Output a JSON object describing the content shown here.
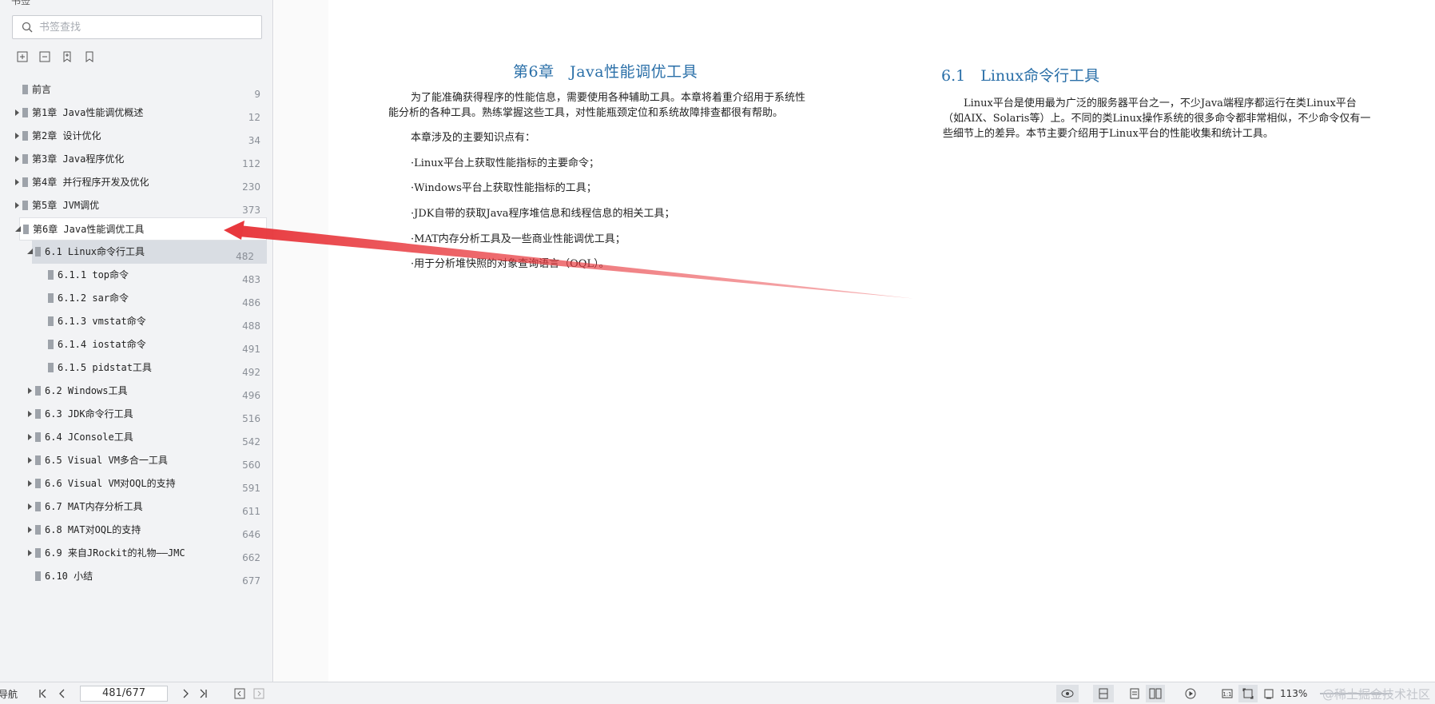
{
  "sidebar": {
    "top_left_label": "书签",
    "search_placeholder": "书签查找",
    "outline": [
      {
        "label": "前言",
        "page": "9",
        "level": 0,
        "expander": "none",
        "cjk": true
      },
      {
        "label": "第1章 Java性能调优概述",
        "page": "12",
        "level": 0,
        "expander": "collapsed"
      },
      {
        "label": "第2章 设计优化",
        "page": "34",
        "level": 0,
        "expander": "collapsed"
      },
      {
        "label": "第3章 Java程序优化",
        "page": "112",
        "level": 0,
        "expander": "collapsed"
      },
      {
        "label": "第4章 并行程序开发及优化",
        "page": "230",
        "level": 0,
        "expander": "collapsed"
      },
      {
        "label": "第5章 JVM调优",
        "page": "373",
        "level": 0,
        "expander": "collapsed"
      },
      {
        "label": "第6章 Java性能调优工具",
        "page": "",
        "level": 0,
        "expander": "expanded",
        "state": "selected"
      },
      {
        "label": "6.1 Linux命令行工具",
        "page": "482",
        "level": 1,
        "expander": "expanded",
        "state": "hover"
      },
      {
        "label": "6.1.1 top命令",
        "page": "483",
        "level": 2,
        "expander": "none"
      },
      {
        "label": "6.1.2 sar命令",
        "page": "486",
        "level": 2,
        "expander": "none"
      },
      {
        "label": "6.1.3 vmstat命令",
        "page": "488",
        "level": 2,
        "expander": "none"
      },
      {
        "label": "6.1.4 iostat命令",
        "page": "491",
        "level": 2,
        "expander": "none"
      },
      {
        "label": "6.1.5 pidstat工具",
        "page": "492",
        "level": 2,
        "expander": "none"
      },
      {
        "label": "6.2 Windows工具",
        "page": "496",
        "level": 1,
        "expander": "collapsed"
      },
      {
        "label": "6.3 JDK命令行工具",
        "page": "516",
        "level": 1,
        "expander": "collapsed"
      },
      {
        "label": "6.4 JConsole工具",
        "page": "542",
        "level": 1,
        "expander": "collapsed"
      },
      {
        "label": "6.5 Visual VM多合一工具",
        "page": "560",
        "level": 1,
        "expander": "collapsed"
      },
      {
        "label": "6.6 Visual VM对OQL的支持",
        "page": "591",
        "level": 1,
        "expander": "collapsed"
      },
      {
        "label": "6.7 MAT内存分析工具",
        "page": "611",
        "level": 1,
        "expander": "collapsed"
      },
      {
        "label": "6.8 MAT对OQL的支持",
        "page": "646",
        "level": 1,
        "expander": "collapsed"
      },
      {
        "label": "6.9 来自JRockit的礼物——JMC",
        "page": "662",
        "level": 1,
        "expander": "collapsed"
      },
      {
        "label": "6.10 小结",
        "page": "677",
        "level": 1,
        "expander": "none"
      }
    ]
  },
  "document": {
    "left_page": {
      "chapter_title": "第6章　Java性能调优工具",
      "intro_line1": "为了能准确获得程序的性能信息，需要使用各种辅助工具。本章将着重介绍用于系统性",
      "intro_line2": "能分析的各种工具。熟练掌握这些工具，对性能瓶颈定位和系统故障排查都很有帮助。",
      "points_intro": "本章涉及的主要知识点有：",
      "points": [
        "·Linux平台上获取性能指标的主要命令；",
        "·Windows平台上获取性能指标的工具；",
        "·JDK自带的获取Java程序堆信息和线程信息的相关工具；",
        "·MAT内存分析工具及一些商业性能调优工具；",
        "·用于分析堆快照的对象查询语言（OQL）。"
      ]
    },
    "right_page": {
      "section_title": "6.1　Linux命令行工具",
      "body_line1": "Linux平台是使用最为广泛的服务器平台之一，不少Java端程序都运行在类Linux平台",
      "body_line2": "（如AIX、Solaris等）上。不同的类Linux操作系统的很多命令都非常相似，不少命令仅有一",
      "body_line3": "些细节上的差异。本节主要介绍用于Linux平台的性能收集和统计工具。"
    }
  },
  "statusbar": {
    "nav_label": "导航",
    "page_indicator": "481/677",
    "zoom": "113%",
    "watermark": "@稀土掘金技术社区"
  },
  "colors": {
    "heading_blue": "#2a6fa8",
    "arrow_red": "#e8383d",
    "sidebar_bg": "#f2f3f5"
  }
}
